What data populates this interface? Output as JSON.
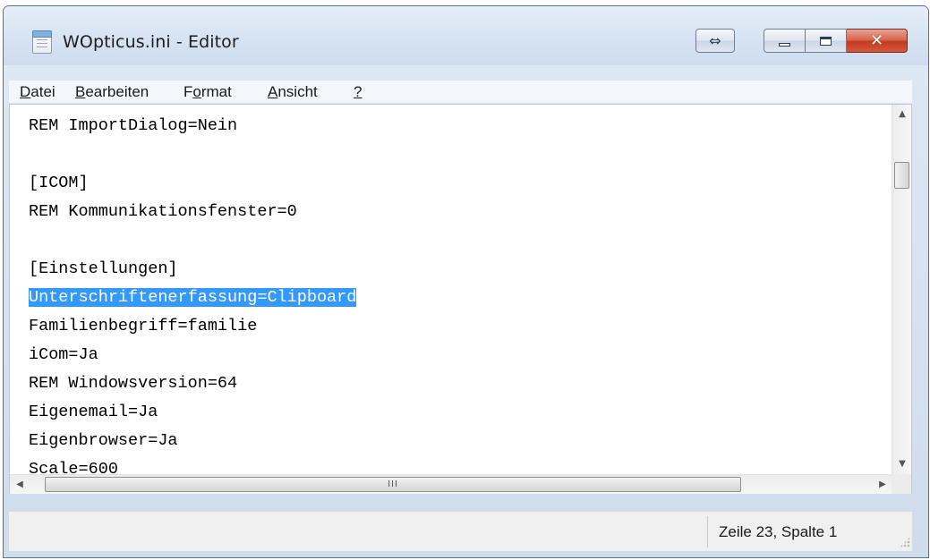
{
  "window": {
    "title": "WOpticus.ini - Editor"
  },
  "menu": [
    {
      "pre": "",
      "u": "D",
      "post": "atei"
    },
    {
      "pre": "",
      "u": "B",
      "post": "earbeiten"
    },
    {
      "pre": "F",
      "u": "o",
      "post": "rmat"
    },
    {
      "pre": "",
      "u": "A",
      "post": "nsicht"
    },
    {
      "pre": "",
      "u": "?",
      "post": ""
    }
  ],
  "editor": {
    "lines": [
      "REM ImportDialog=Nein",
      "",
      "[ICOM]",
      "REM Kommunikationsfenster=0",
      "",
      "[Einstellungen]",
      "Unterschriftenerfassung=Clipboard",
      "Familienbegriff=familie",
      "iCom=Ja",
      "REM Windowsversion=64",
      "Eigenemail=Ja",
      "Eigenbrowser=Ja",
      "Scale=600"
    ],
    "selected_line": 6,
    "selection_color": "#3399ff"
  },
  "scrollbar": {
    "h_grip": "III"
  },
  "status": {
    "position": "Zeile 23, Spalte 1"
  },
  "icons": {
    "swap": "⇔",
    "up": "▲",
    "down": "▼",
    "left": "◀",
    "right": "▶",
    "close": "✕"
  }
}
